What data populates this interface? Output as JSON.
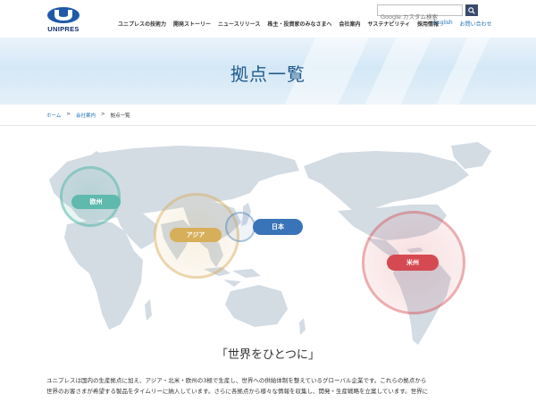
{
  "brand": {
    "logo_text": "UNIPRES"
  },
  "search": {
    "placeholder": "Google カスタム検索"
  },
  "nav": {
    "items": [
      "ユニプレスの技術力",
      "開発ストーリー",
      "ニュースリリース",
      "株主・投資家のみなさまへ",
      "会社案内",
      "サステナビリティ",
      "採用情報"
    ]
  },
  "util": {
    "english": "English",
    "contact": "お問い合わせ"
  },
  "hero": {
    "title": "拠点一覧"
  },
  "breadcrumb": {
    "home": "ホーム",
    "sep": ">",
    "company": "会社案内",
    "current": "拠点一覧"
  },
  "regions": [
    {
      "name": "欧州",
      "color": "#5fb9ad"
    },
    {
      "name": "アジア",
      "color": "#d7ae5a"
    },
    {
      "name": "日本",
      "color": "#3a74b8"
    },
    {
      "name": "米州",
      "color": "#d54a52"
    }
  ],
  "tagline": "「世界をひとつに」",
  "intro": {
    "line1": "ユニプレスは国内の生産拠点に加え、アジア・北米・欧州の3極で生産し、世界への供給体制を整えているグローバル企業です。これらの拠点から",
    "line2": "世界のお客さまが希望する製品をタイムリーに納入しています。さらに各拠点から様々な情報を収集し、開発・生産戦略を立案しています。世界に"
  }
}
